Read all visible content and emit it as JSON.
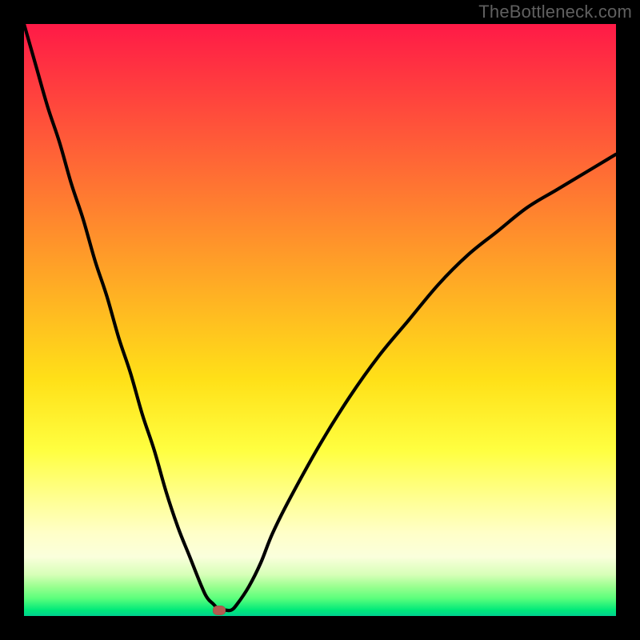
{
  "watermark": {
    "text": "TheBottleneck.com"
  },
  "chart_data": {
    "type": "line",
    "title": "",
    "xlabel": "",
    "ylabel": "",
    "xlim": [
      0,
      100
    ],
    "ylim": [
      0,
      100
    ],
    "grid": false,
    "legend": false,
    "background_gradient": {
      "top": "#ff1a47",
      "mid": "#ffe018",
      "bottom": "#00d090"
    },
    "series": [
      {
        "name": "bottleneck-curve",
        "color": "#000000",
        "x": [
          0,
          2,
          4,
          6,
          8,
          10,
          12,
          14,
          16,
          18,
          20,
          22,
          24,
          26,
          28,
          30,
          31,
          32,
          33,
          34,
          35,
          36,
          38,
          40,
          42,
          45,
          50,
          55,
          60,
          65,
          70,
          75,
          80,
          85,
          90,
          95,
          100
        ],
        "y": [
          100,
          93,
          86,
          80,
          73,
          67,
          60,
          54,
          47,
          41,
          34,
          28,
          21,
          15,
          10,
          5,
          3,
          2,
          1,
          1,
          1,
          2,
          5,
          9,
          14,
          20,
          29,
          37,
          44,
          50,
          56,
          61,
          65,
          69,
          72,
          75,
          78
        ]
      }
    ],
    "marker": {
      "name": "optimal-point",
      "x": 33,
      "y": 1,
      "color": "#b45a50"
    }
  }
}
